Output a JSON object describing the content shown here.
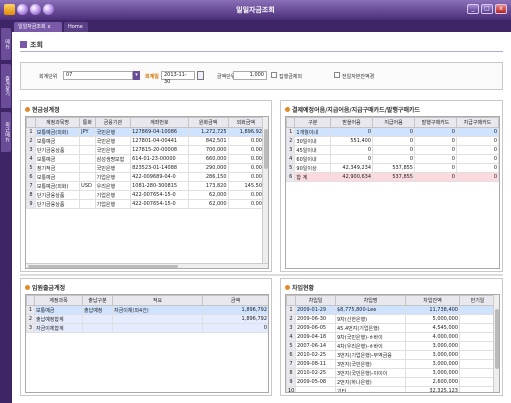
{
  "window": {
    "title": "일일자금조회",
    "controls": [
      "_",
      "□",
      "x"
    ]
  },
  "left_tabs": [
    "메뉴",
    "즐겨찾기",
    "최근메뉴"
  ],
  "tabs": [
    {
      "label": "일일자금조회",
      "close": "x",
      "active": true
    },
    {
      "label": "Home",
      "active": false
    }
  ],
  "page": {
    "title": "조회"
  },
  "filters": {
    "company_label": "회계단위",
    "company_value": "07",
    "date_label": "회계일",
    "date_value": "2013-11-30",
    "unit_label": "금액단위",
    "unit_value": "1,000",
    "cb1_label": "집행금제외",
    "cb2_label": "전일자본잔액경"
  },
  "bank": {
    "title": "현금성계정",
    "columns": [
      "계정과목명",
      "통화",
      "금융기관",
      "계좌번호",
      "원화금액",
      "외화금액"
    ],
    "rows": [
      [
        "보통예금(외화)",
        "JPY",
        "국민은행",
        "127869-04-10086",
        "1,272,725",
        "1,896.92"
      ],
      [
        "보통예금",
        "",
        "국민은행",
        "127801-04-00441",
        "842,501",
        "0.00"
      ],
      [
        "단기금융상품",
        "",
        "국민은행",
        "127815-20-00008",
        "700,000",
        "0.00"
      ],
      [
        "보통예금",
        "",
        "삼성생명보험",
        "614-01-23-00000",
        "660,000",
        "0.00"
      ],
      [
        "정기적금",
        "",
        "국민은행",
        "823523-01-14088",
        "290,000",
        "0.00"
      ],
      [
        "보통예금",
        "",
        "기업은행",
        "422-009689-04-0",
        "286,150",
        "0.00"
      ],
      [
        "보통예금(외화)",
        "USD",
        "우리은행",
        "1081-280-300815",
        "173,820",
        "145.50"
      ],
      [
        "단기금융상품",
        "",
        "기업은행",
        "422-007654-15-0",
        "62,000",
        "0.00"
      ],
      [
        "단기금융상품",
        "",
        "기업은행",
        "422-007654-15-0",
        "62,000",
        "0.00"
      ]
    ]
  },
  "settle": {
    "title": "결제예정어음/지급어음/지급구매카드/발행구매카드",
    "columns": [
      "구분",
      "받을어음",
      "지급어음",
      "발행구매카드",
      "지급구매카드"
    ],
    "rows": [
      [
        "1개월이내",
        "0",
        "0",
        "0",
        "0"
      ],
      [
        "30일이내",
        "551,400",
        "0",
        "0",
        "0"
      ],
      [
        "45일이내",
        "0",
        "0",
        "0",
        "0"
      ],
      [
        "60일이내",
        "0",
        "0",
        "0",
        "0"
      ],
      [
        "90일이상",
        "42,349,234",
        "537,855",
        "0",
        "0"
      ],
      [
        "합  계",
        "42,900,634",
        "537,855",
        "0",
        "0"
      ]
    ]
  },
  "transfer": {
    "title": "임원출금계정",
    "columns": [
      "계정과목",
      "출납구분",
      "적요",
      "금액"
    ],
    "rows": [
      [
        "보통예금",
        "출납예정",
        "자금이체(외4건)",
        "1,896,792"
      ],
      [
        "출납예정합계",
        "",
        "",
        "1,896,792"
      ],
      [
        "자금이체합계",
        "",
        "",
        "0"
      ]
    ]
  },
  "loan": {
    "title": "차입현황",
    "columns": [
      "차입일",
      "차입명",
      "차입잔액",
      "만기일"
    ],
    "rows": [
      [
        "2009-01-29",
        "$8,775,800-Lee",
        "11,738,400",
        ""
      ],
      [
        "2009-06-30",
        "9차(신한은행)",
        "5,000,000",
        ""
      ],
      [
        "2009-06-05",
        "45.4번지(기업은행)",
        "4,545,000",
        ""
      ],
      [
        "2009-04-18",
        "9차(국민은행)-ㅎ바이",
        "4,000,000",
        ""
      ],
      [
        "2007-06-14",
        "4차(우리은행)-ㅎ바이",
        "3,000,000",
        ""
      ],
      [
        "2010-02-25",
        "3번지(기업은행)-무역금융",
        "3,000,000",
        ""
      ],
      [
        "2009-08-11",
        "3번지(국민은행)",
        "3,000,000",
        ""
      ],
      [
        "2010-02-25",
        "3번지(국민은행)-이이이",
        "3,000,000",
        ""
      ],
      [
        "2009-05-08",
        "2번지(하나은행)",
        "2,600,000",
        ""
      ],
      [
        "",
        "기타",
        "32,325,123",
        ""
      ]
    ]
  }
}
